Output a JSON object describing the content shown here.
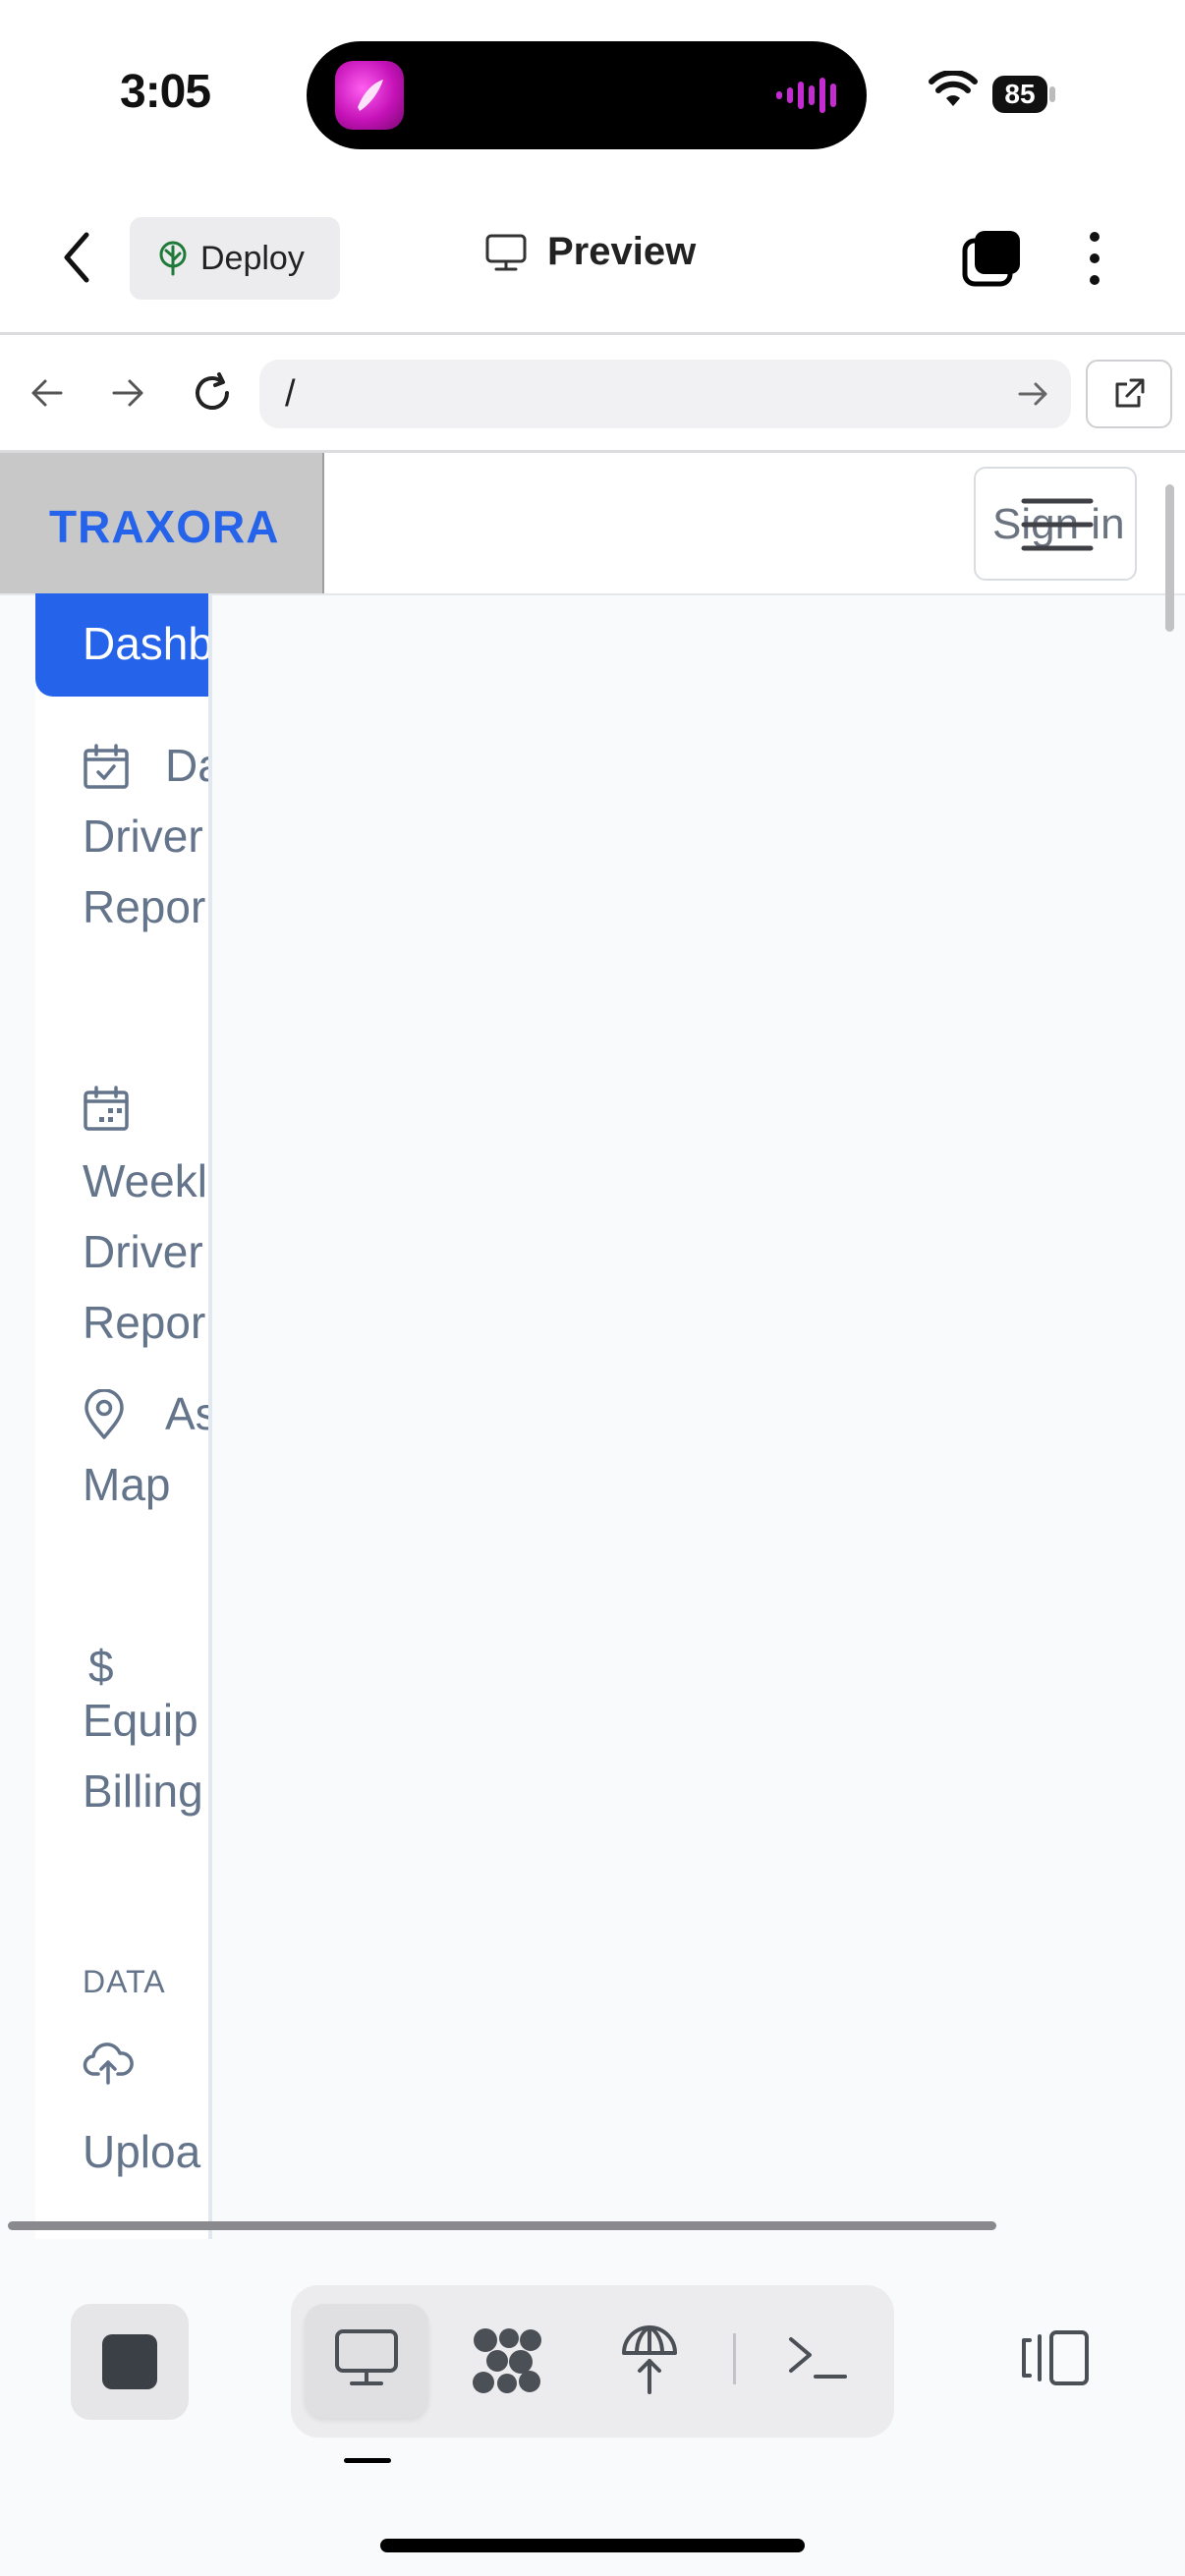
{
  "status_bar": {
    "time": "3:05",
    "battery": "85"
  },
  "header": {
    "deploy_label": "Deploy",
    "preview_label": "Preview"
  },
  "browser": {
    "url": "/"
  },
  "site": {
    "brand": "TRAXORA",
    "signin_label": "Sign in",
    "sidebar": {
      "active_label": "Dashb",
      "items": [
        {
          "icon": "calendar-check-icon",
          "label": "Da\nDriver\nRepor"
        },
        {
          "icon": "calendar-week-icon",
          "label": "Weekl\nDriver\nRepor"
        },
        {
          "icon": "map-pin-icon",
          "label": "As\nMap"
        },
        {
          "icon": "dollar-icon",
          "label": "Equip\nBilling"
        }
      ],
      "section_heading": "DATA",
      "upload": {
        "icon": "cloud-upload-icon",
        "label": "Uploa"
      }
    }
  },
  "toolbar": {
    "tools": [
      "preview-icon",
      "graph-icon",
      "deploy-icon",
      "terminal-icon"
    ],
    "stop_icon": "stop-icon",
    "layout_icon": "split-layout-icon"
  }
}
